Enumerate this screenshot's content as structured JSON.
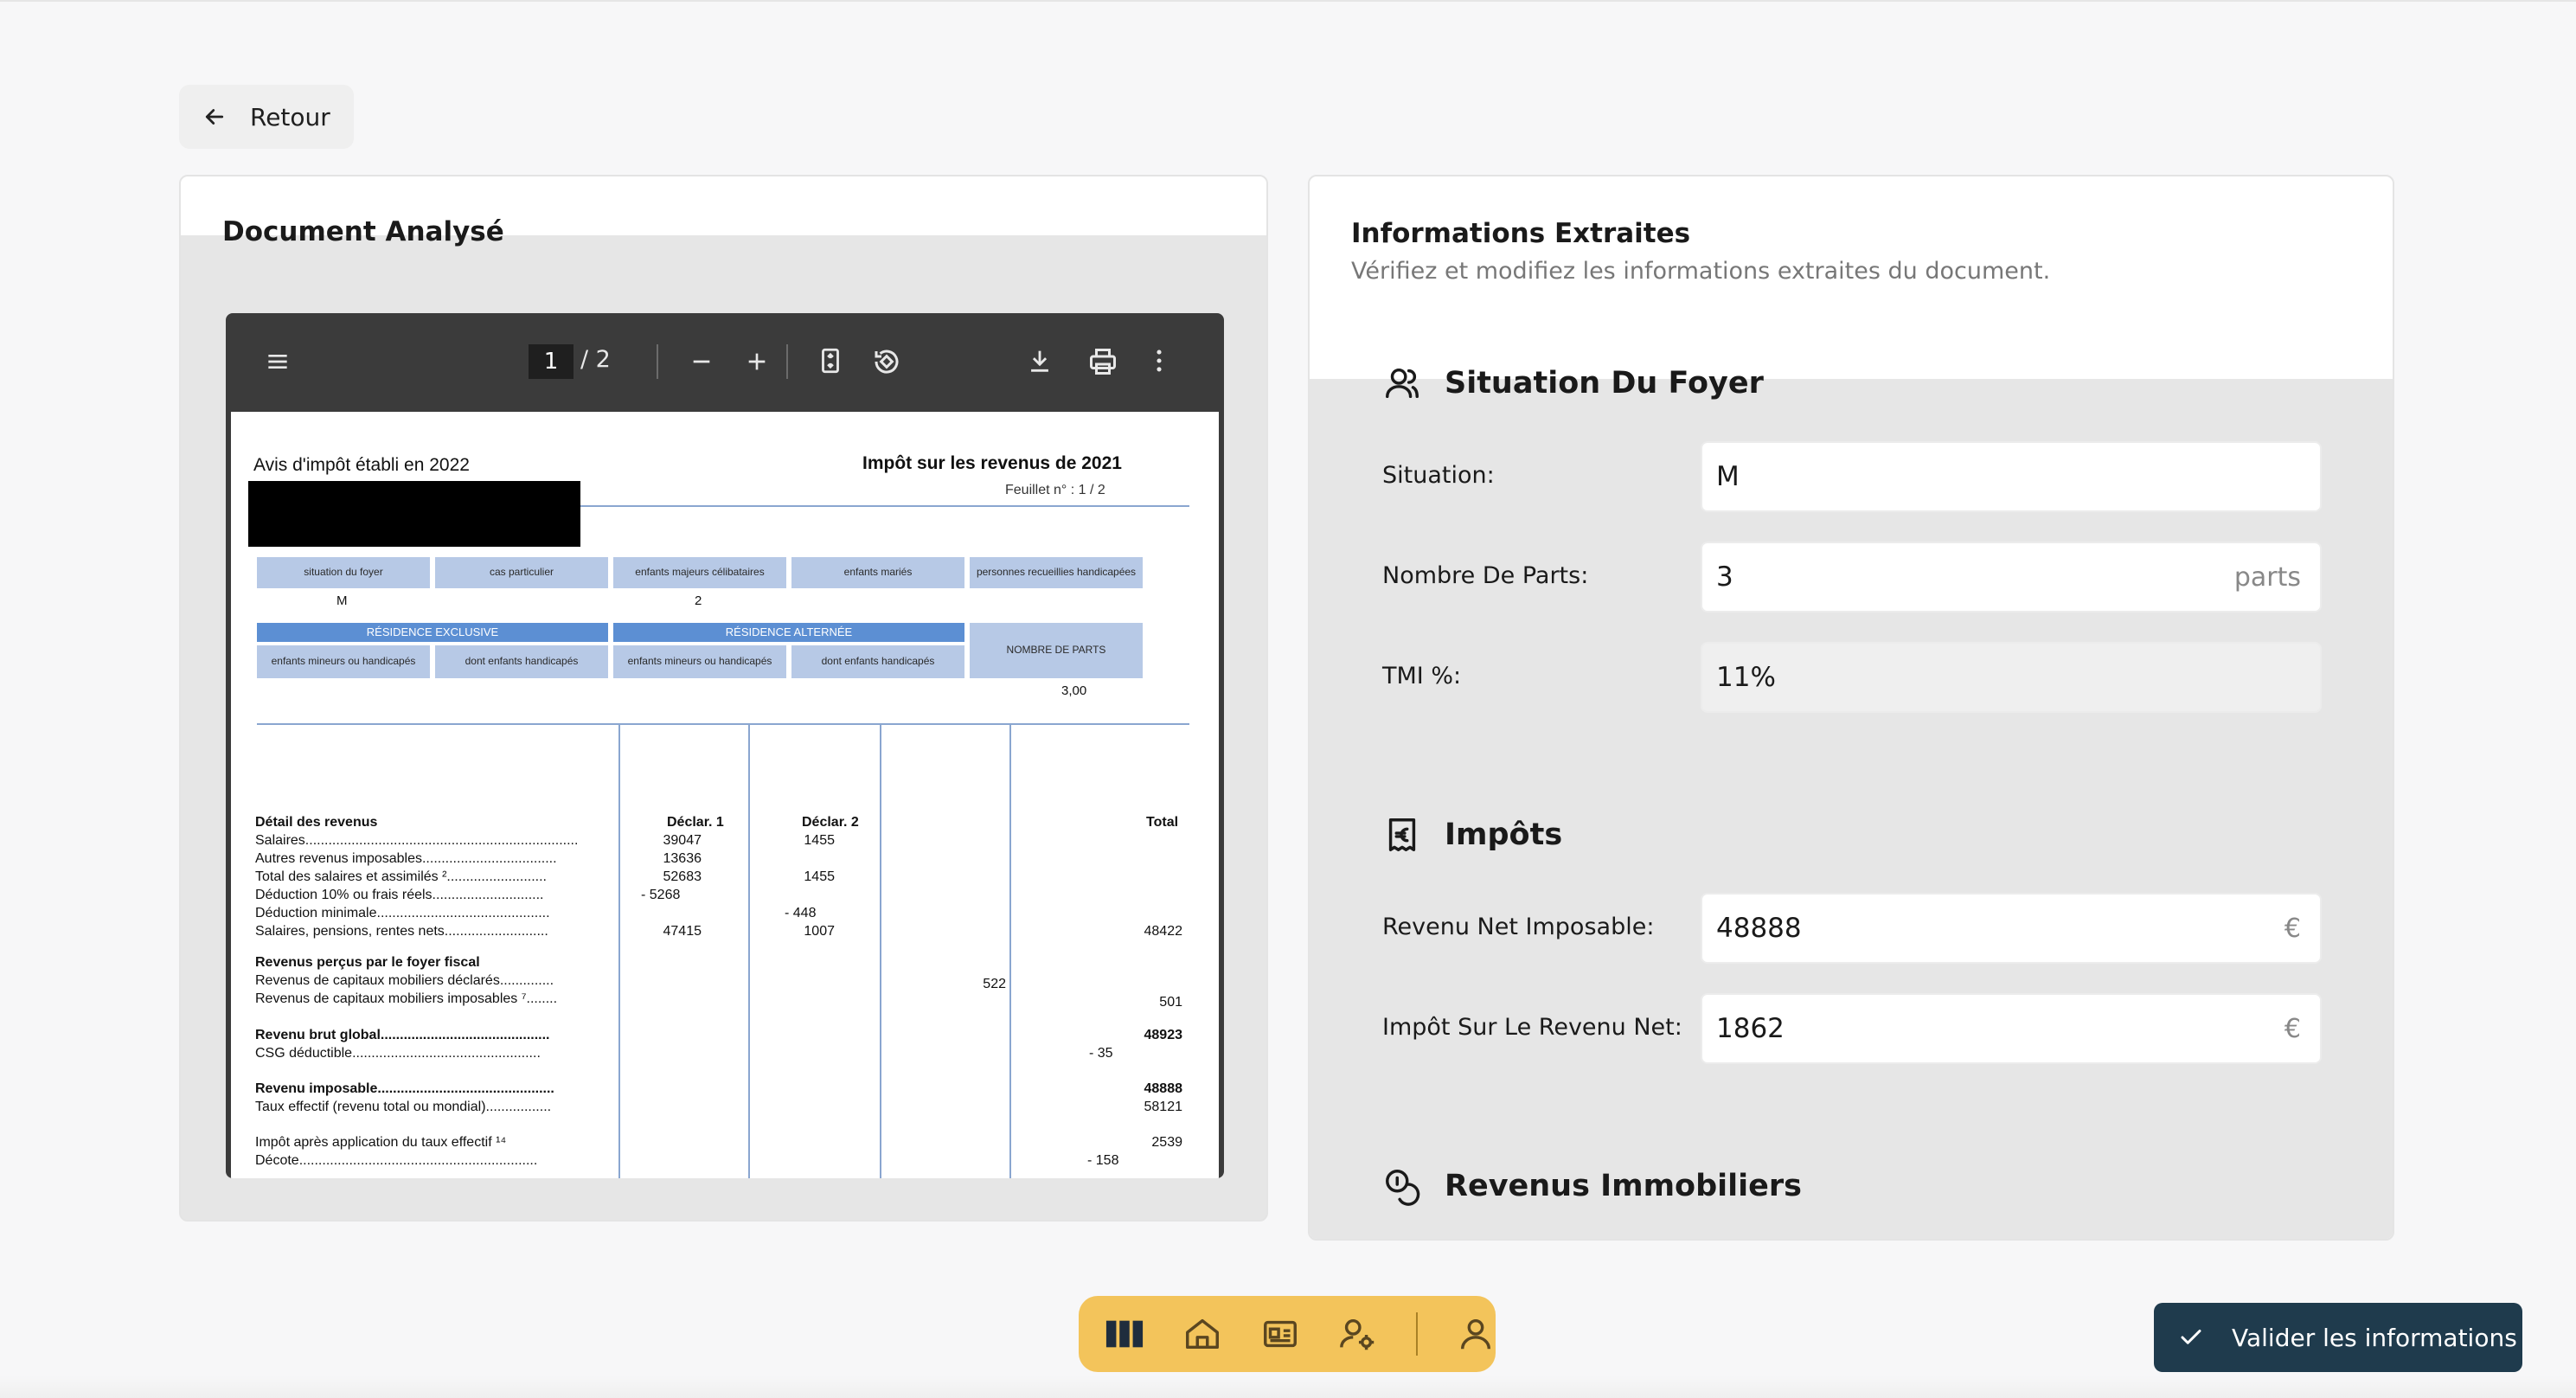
{
  "nav": {
    "back_label": "Retour"
  },
  "left": {
    "title": "Document Analysé",
    "viewer": {
      "current_page": "1",
      "total_pages": "/ 2"
    },
    "doc": {
      "header_left": "Avis d'impôt établi en 2022",
      "header_right": "Impôt sur les revenus de 2021",
      "feuillet": "Feuillet n° :  1  /  2",
      "row1": [
        "situation du foyer",
        "cas particulier",
        "enfants majeurs célibataires",
        "enfants mariés",
        "personnes recueillies handicapées"
      ],
      "row1_values": {
        "situation": "M",
        "majeurs": "2"
      },
      "res_exclusive": "RÉSIDENCE EXCLUSIVE",
      "res_alternee": "RÉSIDENCE ALTERNÉE",
      "nombre_parts": "NOMBRE DE PARTS",
      "row2": [
        "enfants mineurs ou handicapés",
        "dont enfants handicapés",
        "enfants mineurs ou handicapés",
        "dont enfants handicapés"
      ],
      "parts_value": "3,00",
      "col_declar1": "Déclar. 1",
      "col_declar2": "Déclar. 2",
      "col_total": "Total",
      "lines": [
        {
          "label": "Détail des revenus",
          "bold": true
        },
        {
          "label": "Salaires.......................................................................",
          "d1": "39047",
          "d2": "1455"
        },
        {
          "label": "Autres revenus imposables...................................",
          "d1": "13636"
        },
        {
          "label": "Total des salaires et assimilés ²..........................",
          "d1": "52683",
          "d2": "1455"
        },
        {
          "label": "Déduction 10% ou frais réels.............................",
          "d1": "-      5268"
        },
        {
          "label": "Déduction minimale.............................................",
          "d2": "-      448"
        },
        {
          "label": "Salaires, pensions, rentes nets...........................",
          "d1": "47415",
          "d2": "1007",
          "total": "48422"
        },
        {
          "label": "Revenus perçus par le foyer fiscal",
          "bold": true
        },
        {
          "label": "Revenus de capitaux mobiliers déclarés..............",
          "d4": "522"
        },
        {
          "label": "Revenus de capitaux mobiliers imposables ⁷........",
          "total": "501"
        },
        {
          "label": "Revenu brut global............................................",
          "bold": true,
          "total": "48923"
        },
        {
          "label": "CSG déductible.................................................",
          "total": "-        35"
        },
        {
          "label": "Revenu imposable..............................................",
          "bold": true,
          "total": "48888"
        },
        {
          "label": "Taux effectif (revenu total ou mondial).................",
          "total": "58121"
        },
        {
          "label": "Impôt après application du taux effectif ¹⁴",
          "total": "2539"
        },
        {
          "label": "Décote..............................................................",
          "total": "-      158"
        }
      ]
    }
  },
  "right": {
    "title": "Informations Extraites",
    "subtitle": "Vérifiez et modifiez les informations extraites du document.",
    "section_foyer": "Situation Du Foyer",
    "situation_label": "Situation:",
    "situation_value": "M",
    "parts_label": "Nombre De Parts:",
    "parts_value": "3",
    "parts_suffix": "parts",
    "tmi_label": "TMI %:",
    "tmi_value": "11%",
    "section_impots": "Impôts",
    "rni_label": "Revenu Net Imposable:",
    "rni_value": "48888",
    "irn_label": "Impôt Sur Le Revenu Net:",
    "irn_value": "1862",
    "currency": "€",
    "section_immo": "Revenus Immobiliers"
  },
  "actions": {
    "validate_label": "Valider les informations"
  },
  "colors": {
    "dock": "#f3c45b",
    "validate_bg": "#1f3b4d",
    "accent_blue": "#5c8fd3"
  },
  "icons": [
    "arrow-left-icon",
    "menu-icon",
    "minus-icon",
    "plus-icon",
    "fit-page-icon",
    "rotate-icon",
    "download-icon",
    "print-icon",
    "more-vertical-icon",
    "users-icon",
    "receipt-euro-icon",
    "coins-icon",
    "columns-icon",
    "home-icon",
    "id-card-icon",
    "user-gear-icon",
    "user-icon",
    "check-icon"
  ]
}
